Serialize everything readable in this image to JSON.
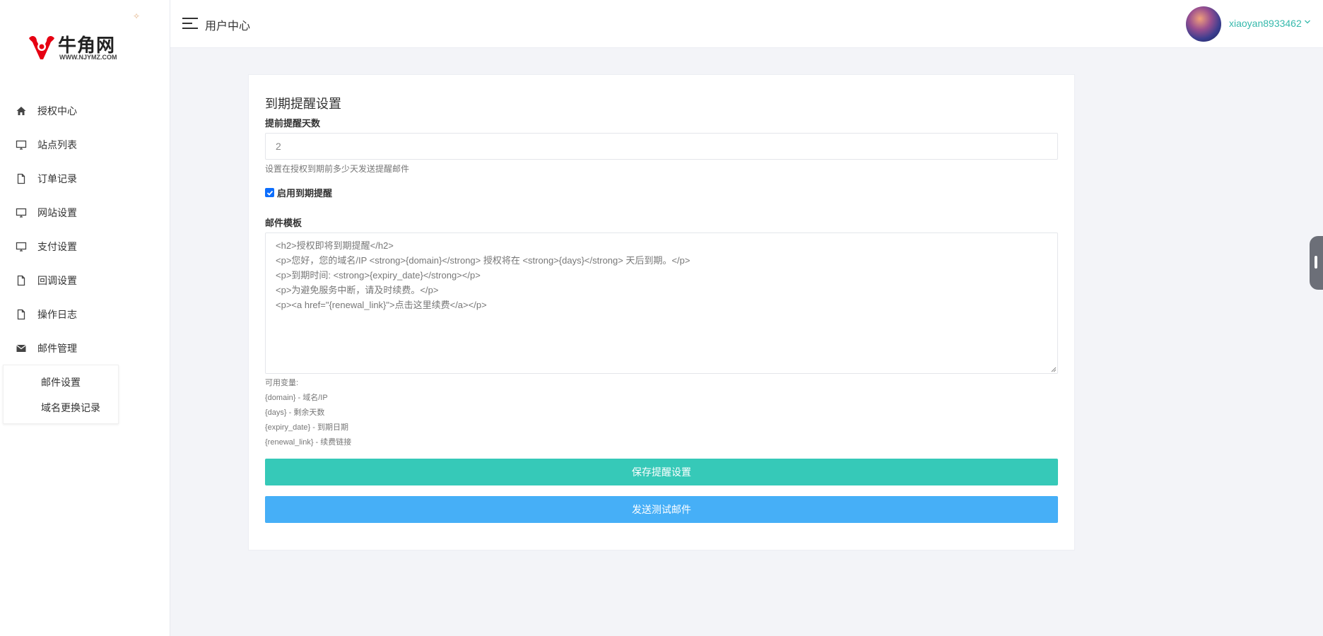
{
  "logo": {
    "text": "牛角网",
    "sub": "WWW.NJYMZ.COM"
  },
  "sidebar": {
    "items": [
      {
        "label": "授权中心",
        "icon": "home-icon"
      },
      {
        "label": "站点列表",
        "icon": "monitor-icon"
      },
      {
        "label": "订单记录",
        "icon": "file-icon"
      },
      {
        "label": "网站设置",
        "icon": "monitor-icon"
      },
      {
        "label": "支付设置",
        "icon": "monitor-icon"
      },
      {
        "label": "回调设置",
        "icon": "file-icon"
      },
      {
        "label": "操作日志",
        "icon": "file-icon"
      },
      {
        "label": "邮件管理",
        "icon": "mail-icon"
      }
    ],
    "submenu": [
      {
        "label": "邮件设置"
      },
      {
        "label": "域名更换记录"
      }
    ]
  },
  "header": {
    "title": "用户中心",
    "username": "xiaoyan8933462"
  },
  "form": {
    "title": "到期提醒设置",
    "days_label": "提前提醒天数",
    "days_value": "2",
    "days_hint": "设置在授权到期前多少天发送提醒邮件",
    "enable_label": "启用到期提醒",
    "enable_checked": true,
    "template_label": "邮件模板",
    "template_value": "<h2>授权即将到期提醒</h2>\n<p>您好，您的域名/IP <strong>{domain}</strong> 授权将在 <strong>{days}</strong> 天后到期。</p>\n<p>到期时间: <strong>{expiry_date}</strong></p>\n<p>为避免服务中断，请及时续费。</p>\n<p><a href=\"{renewal_link}\">点击这里续费</a></p>",
    "vars_title": "可用变量:",
    "vars": [
      "{domain} - 域名/IP",
      "{days} - 剩余天数",
      "{expiry_date} - 到期日期",
      "{renewal_link} - 续费链接"
    ],
    "save_button": "保存提醒设置",
    "test_button": "发送测试邮件"
  },
  "colors": {
    "accent": "#36c9b8",
    "primary": "#46aff7",
    "username": "#36b9ac",
    "logo_red": "#e60012"
  }
}
